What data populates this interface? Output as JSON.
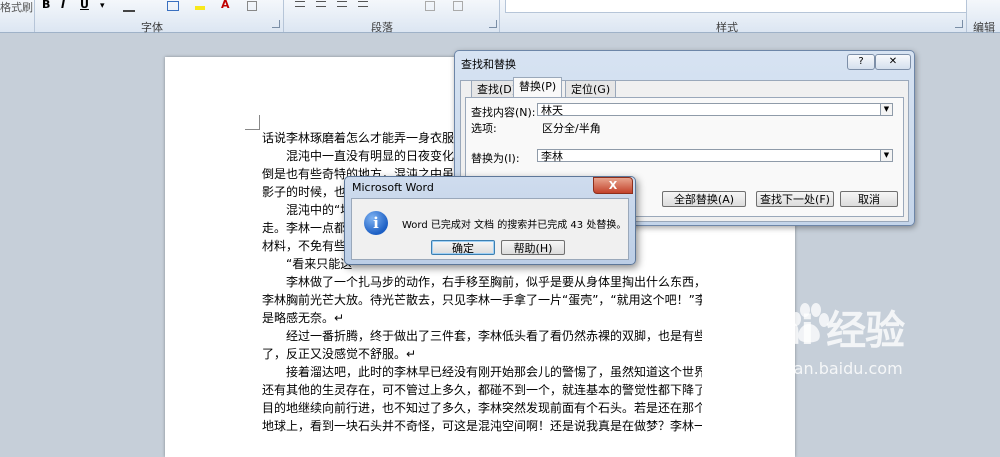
{
  "ribbon": {
    "clipboard_fragment": "格式刷",
    "font_bold": "B",
    "font_italic": "I",
    "font_underline": "U",
    "font_group": "字体",
    "paragraph_group": "段落",
    "styles_group": "样式",
    "right_fragment": "编辑"
  },
  "document": {
    "lines": [
      {
        "text": "话说李林琢磨着怎么才能弄一身衣服，-",
        "indent": false
      },
      {
        "text": "混沌中一直没有明显的日夜变化，就",
        "indent": true
      },
      {
        "text": "倒是也有些奇特的地方，混沌之中虽然",
        "indent": false
      },
      {
        "text": "影子的时候，也是",
        "indent": false
      },
      {
        "text": "混沌中的“地",
        "indent": true
      },
      {
        "text": "走。李林一点都",
        "indent": false
      },
      {
        "text": "材料，不免有些",
        "indent": false
      },
      {
        "text": "“看来只能这",
        "indent": true
      },
      {
        "text": "李林做了一个扎马步的动作，右手移至胸前，似乎是要从身体里掏出什么东西，一时间",
        "indent": true
      },
      {
        "text": "李林胸前光芒大放。待光芒散去，只见李林一手拿了一片“蛋壳”，“就用这个吧！”李林也",
        "indent": false
      },
      {
        "text": "是略感无奈。↵",
        "indent": false
      },
      {
        "text": "经过一番折腾，终于做出了三件套，李林低头看了看仍然赤裸的双脚，也是有些无所谓",
        "indent": true
      },
      {
        "text": "了，反正又没感觉不舒服。↵",
        "indent": false
      },
      {
        "text": "接着溜达吧，此时的李林早已经没有刚开始那会儿的警惕了，虽然知道这个世界里肯定",
        "indent": true
      },
      {
        "text": "还有其他的生灵存在，可不管过上多久，都碰不到一个，就连基本的警觉性都下降了。漫无",
        "indent": false
      },
      {
        "text": "目的地继续向前行进，也不知过了多久，李林突然发现前面有个石头。若是还在那个熟悉的",
        "indent": false
      },
      {
        "text": "地球上，看到一块石头并不奇怪，可这是混沌空间啊！还是说我真是在做梦？李林一时之间",
        "indent": false
      }
    ]
  },
  "find_replace": {
    "title": "查找和替换",
    "help": "?",
    "close": "✕",
    "tabs": [
      "查找(D)",
      "替换(P)",
      "定位(G)"
    ],
    "active_tab": 1,
    "find_label": "查找内容(N):",
    "find_value": "林天",
    "options_label": "选项:",
    "options_value": "区分全/半角",
    "replace_label": "替换为(I):",
    "replace_value": "李林",
    "buttons": [
      "全部替换(A)",
      "查找下一处(F)",
      "取消"
    ]
  },
  "message_box": {
    "title": "Microsoft Word",
    "close": "X",
    "icon": "info-icon",
    "icon_glyph": "i",
    "message": "Word 已完成对 文档 的搜索并已完成 43 处替换。",
    "ok": "确定",
    "help": "帮助(H)"
  },
  "watermark": {
    "brand": "Bai  经验",
    "url": "jingyan.baidu.com"
  },
  "colors": {
    "accent": "#1c5fc4",
    "close_red": "#c3422b"
  }
}
